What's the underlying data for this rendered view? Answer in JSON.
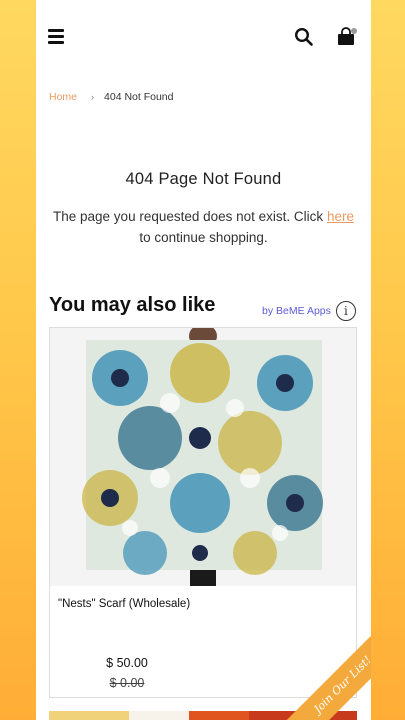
{
  "header": {
    "menu_icon": "hamburger-menu-icon",
    "search_icon": "search-icon",
    "cart_icon": "shopping-bag-icon"
  },
  "breadcrumb": {
    "home": "Home",
    "separator": "›",
    "current": "404 Not Found"
  },
  "error": {
    "title": "404 Page Not Found",
    "message_before": "The page you requested does not exist. Click ",
    "link": "here",
    "message_after": " to continue shopping."
  },
  "recommendations": {
    "title": "You may also like",
    "provider": "by BeME Apps",
    "info_icon": "info-icon",
    "products": [
      {
        "name": "\"Nests\" Scarf (Wholesale)",
        "price": "$ 50.00",
        "compare_price": "$ 0.00"
      }
    ]
  },
  "join_ribbon": {
    "label": "Join Our List!"
  },
  "colors": {
    "accent": "#e89a62",
    "provider_link": "#5b5bd6",
    "ribbon": "#f4a93c",
    "background_top": "#ffd860",
    "background_bottom": "#ffad36"
  }
}
